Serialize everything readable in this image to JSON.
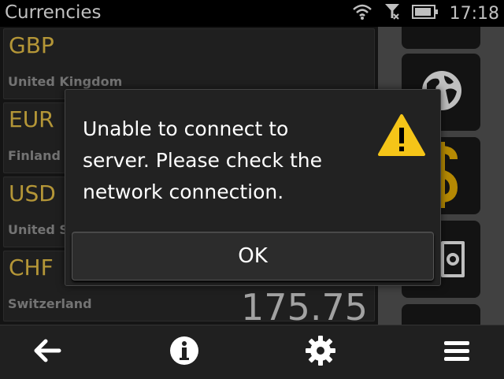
{
  "status_bar": {
    "title": "Currencies",
    "time": "17:18",
    "icons": [
      "wifi-icon",
      "no-sim-icon",
      "battery-icon"
    ]
  },
  "currencies": [
    {
      "code": "GBP",
      "country": "United Kingdom",
      "value": ""
    },
    {
      "code": "EUR",
      "country": "Finland",
      "value": ""
    },
    {
      "code": "USD",
      "country": "United S",
      "value": ""
    },
    {
      "code": "CHF",
      "country": "Switzerland",
      "value": "175.75"
    }
  ],
  "side_tiles": [
    "tile-top-partial",
    "globe-icon",
    "dollar-icon",
    "safe-icon",
    "tile-bottom-partial"
  ],
  "dialog": {
    "message": "Unable to connect to server. Please check the network connection.",
    "icon": "warning-icon",
    "ok_label": "OK"
  },
  "toolbar": {
    "items": [
      "back-arrow-icon",
      "info-icon",
      "gear-icon",
      "menu-icon"
    ]
  },
  "colors": {
    "accent": "#f1c84a",
    "warning": "#f5c518",
    "background": "#1b1b1b"
  }
}
